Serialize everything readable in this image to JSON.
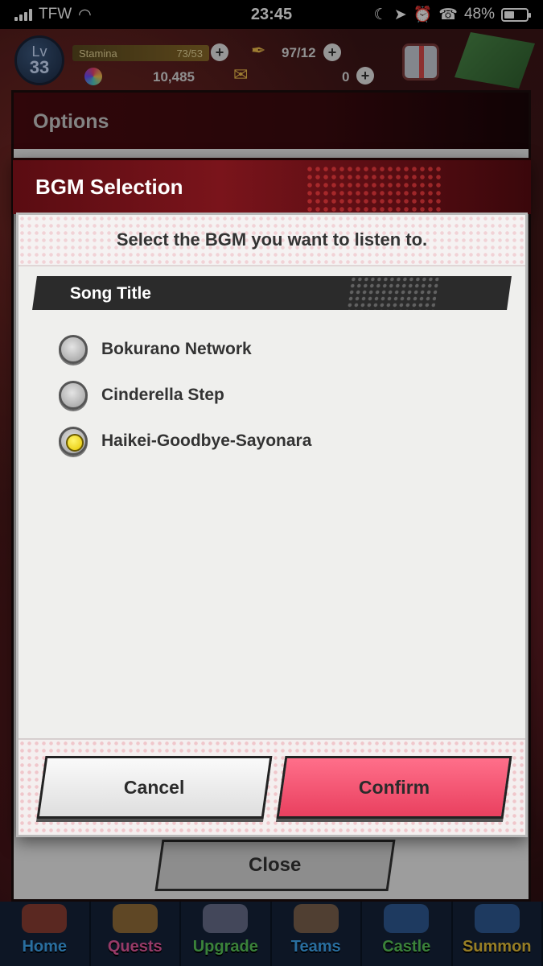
{
  "status_bar": {
    "carrier": "TFW",
    "time": "23:45",
    "battery_percent": "48%"
  },
  "hud": {
    "level_label": "Lv",
    "level": "33",
    "stamina_label": "Stamina",
    "stamina": "73/53",
    "quill": "97/12",
    "gems": "10,485",
    "tickets": "0"
  },
  "options": {
    "title": "Options",
    "close_label": "Close"
  },
  "dialog": {
    "title": "BGM Selection",
    "subtitle": "Select the BGM you want to listen to.",
    "column_header": "Song Title",
    "songs": [
      {
        "title": "Bokurano Network",
        "selected": false
      },
      {
        "title": "Cinderella Step",
        "selected": false
      },
      {
        "title": "Haikei-Goodbye-Sayonara",
        "selected": true
      }
    ],
    "cancel_label": "Cancel",
    "confirm_label": "Confirm"
  },
  "tabs": [
    {
      "label": "Home",
      "color": "#3fa9f5"
    },
    {
      "label": "Quests",
      "color": "#e85aa0"
    },
    {
      "label": "Upgrade",
      "color": "#5ac85a"
    },
    {
      "label": "Teams",
      "color": "#3fa9f5"
    },
    {
      "label": "Castle",
      "color": "#5ac85a"
    },
    {
      "label": "Summon",
      "color": "#e8c23a"
    }
  ],
  "colors": {
    "accent_red": "#7a141b",
    "confirm_pink": "#e9405f",
    "radio_selected": "#f2d800"
  }
}
